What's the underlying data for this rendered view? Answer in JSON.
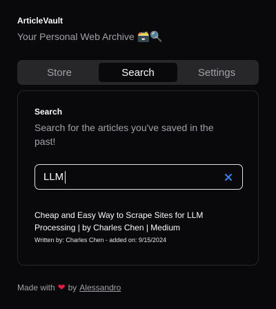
{
  "header": {
    "title": "ArticleVault",
    "subtitle": "Your Personal Web Archive",
    "subtitle_emoji": "🗃️🔍"
  },
  "tabs": [
    {
      "label": "Store",
      "active": false
    },
    {
      "label": "Search",
      "active": true
    },
    {
      "label": "Settings",
      "active": false
    }
  ],
  "search_panel": {
    "title": "Search",
    "description": "Search for the articles you've saved in the past!",
    "input_value": "LLM",
    "clear_icon": "x-icon"
  },
  "results": [
    {
      "title": "Cheap and Easy Way to Scrape Sites for LLM Processing | by Charles Chen | Medium",
      "meta": "Written by: Charles Chen - added on: 9/15/2024"
    }
  ],
  "footer": {
    "prefix": "Made with",
    "heart": "❤",
    "by": "by",
    "author": "Alessandro"
  },
  "colors": {
    "background": "#09090b",
    "tab_bar": "#27272a",
    "muted_text": "#a1a1aa",
    "heart": "#e11d48",
    "clear_icon": "#3b82f6"
  }
}
